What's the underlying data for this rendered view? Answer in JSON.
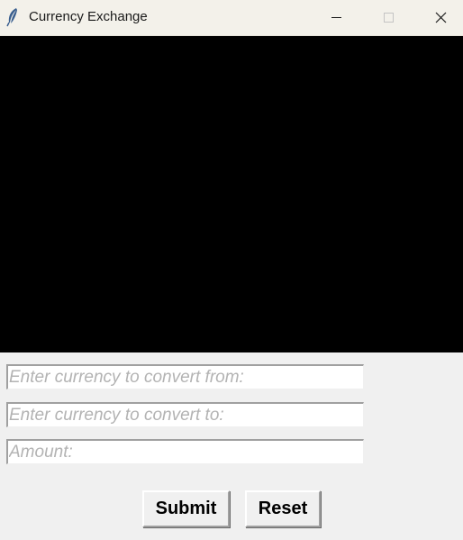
{
  "window": {
    "title": "Currency Exchange",
    "app_icon": "feather-icon",
    "controls": {
      "minimize_icon": "minimize-icon",
      "maximize_icon": "maximize-icon",
      "close_icon": "close-icon"
    }
  },
  "form": {
    "from_placeholder": "Enter currency to convert from:",
    "to_placeholder": "Enter currency to convert to:",
    "amount_placeholder": "Amount:",
    "submit_label": "Submit",
    "reset_label": "Reset"
  },
  "colors": {
    "canvas_background": "#000000",
    "window_background": "#f0f0f0",
    "titlebar_background": "#f3f1ea",
    "placeholder_text": "#b3b3b3"
  }
}
